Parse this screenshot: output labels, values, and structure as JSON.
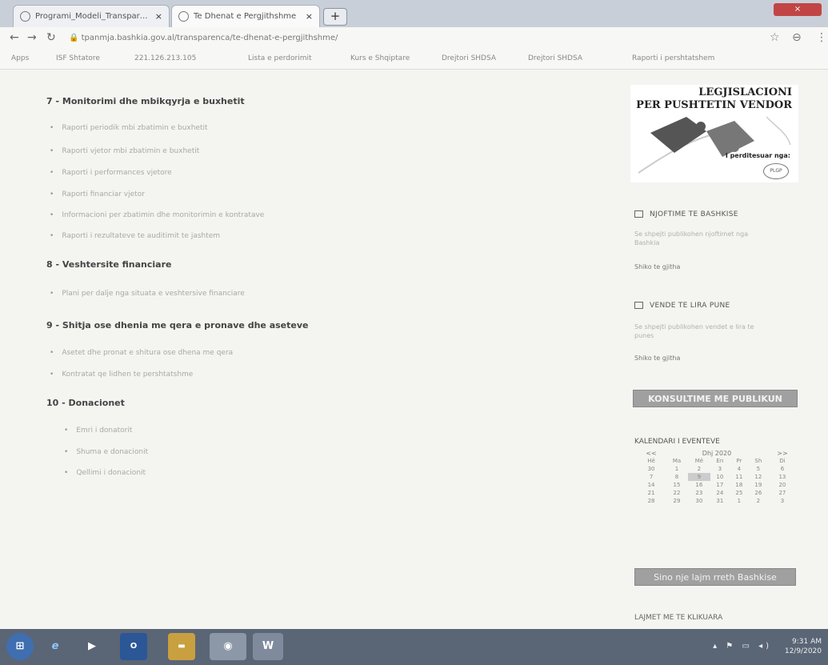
{
  "browser": {
    "tabs": [
      {
        "label": "Programi_Modeli_Transparenc"
      },
      {
        "label": "Te Dhenat e Pergjithshme"
      }
    ],
    "close_glyph": "×",
    "new_tab_glyph": "+",
    "url": "tpanmja.bashkia.gov.al/transparenca/te-dhenat-e-pergjithshme/",
    "bookmarks": [
      "Apps",
      "ISF Shtatore",
      "221.126.213.105",
      "Lista e perdorimit",
      "Kurs e Shqiptare",
      "Drejtori SHDSA",
      "Drejtori SHDSA",
      "Raporti i pershtatshem"
    ]
  },
  "main": {
    "sections": [
      {
        "title": "7 - Monitorimi dhe mbikqyrja e buxhetit",
        "items": [
          "Raporti periodik mbi zbatimin e buxhetit",
          "Raporti vjetor mbi zbatimin e buxhetit",
          "Raporti i performances vjetore",
          "Raporti financiar vjetor",
          "Informacioni per zbatimin dhe monitorimin e kontratave",
          "Raporti i rezultateve te auditimit te jashtem"
        ]
      },
      {
        "title": "8 - Veshtersite financiare",
        "items": [
          "Plani per dalje nga situata e veshtersive financiare"
        ]
      },
      {
        "title": "9 - Shitja ose dhenia me qera e pronave dhe aseteve",
        "items": [
          "Asetet dhe pronat e shitura ose dhena me qera",
          "Kontratat qe lidhen te pershtatshme"
        ]
      },
      {
        "title": "10 - Donacionet",
        "items": [
          "Emri i donatorit",
          "Shuma e donacionit",
          "Qellimi i donacionit"
        ]
      }
    ]
  },
  "sidebar": {
    "banner": {
      "title_line1": "LEGJISLACIONI",
      "title_line2": "PER PUSHTETIN VENDOR",
      "subtitle": "I perditesuar nga:",
      "logo_text": "PLGP"
    },
    "announcements": {
      "heading": "NJOFTIME TE BASHKISE",
      "text": "Se shpejti publikohen njoftimet nga Bashkia",
      "link": "Shiko te gjitha"
    },
    "jobs": {
      "heading": "VENDE TE LIRA PUNE",
      "text": "Se shpejti publikohen vendet e lira te punes",
      "link": "Shiko te gjitha"
    },
    "consult_button": "KONSULTIME ME PUBLIKUN",
    "calendar": {
      "title": "KALENDARI I EVENTEVE",
      "month": "Dhj 2020",
      "prev": "<<",
      "next": ">>",
      "weekdays": [
        "Hë",
        "Ma",
        "Më",
        "En",
        "Pr",
        "Sh",
        "Di"
      ],
      "weeks": [
        [
          "30",
          "1",
          "2",
          "3",
          "4",
          "5",
          "6"
        ],
        [
          "7",
          "8",
          "9",
          "10",
          "11",
          "12",
          "13"
        ],
        [
          "14",
          "15",
          "16",
          "17",
          "18",
          "19",
          "20"
        ],
        [
          "21",
          "22",
          "23",
          "24",
          "25",
          "26",
          "27"
        ],
        [
          "28",
          "29",
          "30",
          "31",
          "1",
          "2",
          "3"
        ]
      ]
    },
    "news_button": "Sino nje lajm rreth Bashkise",
    "news_title": "LAJMET ME TE KLIKUARA"
  },
  "taskbar": {
    "time": "9:31 AM",
    "date": "12/9/2020"
  }
}
